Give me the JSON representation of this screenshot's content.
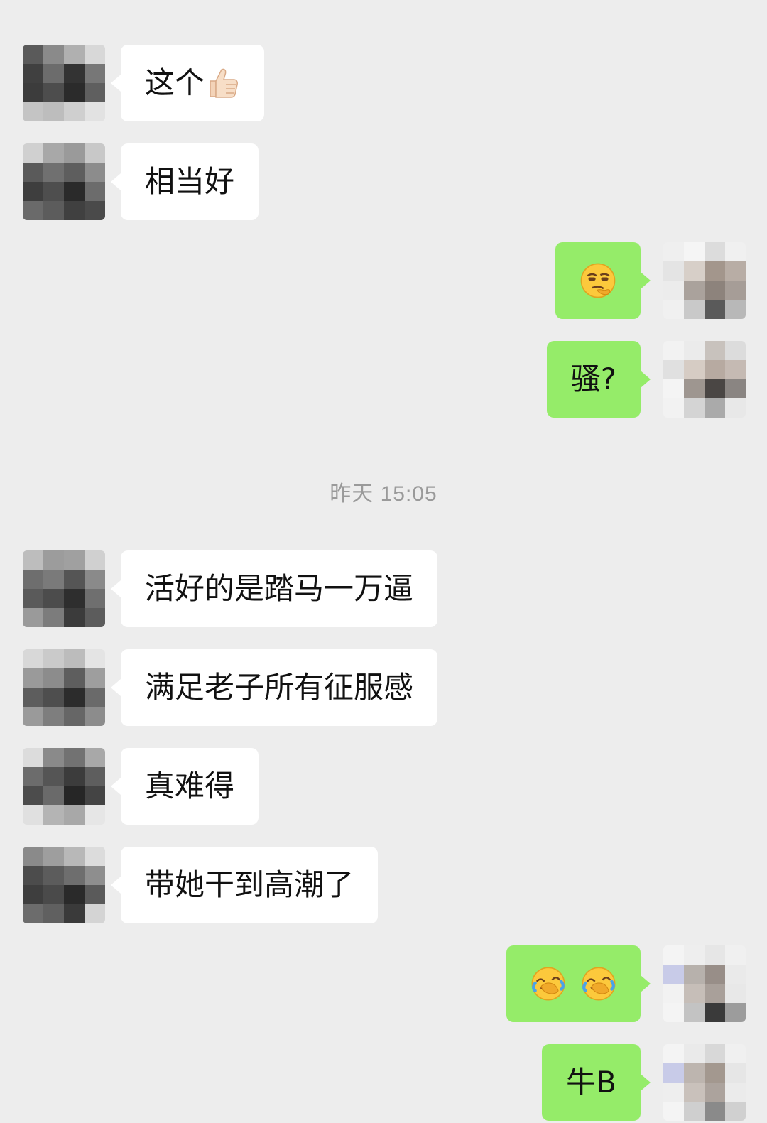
{
  "colors": {
    "background": "#ededed",
    "incoming_bubble": "#ffffff",
    "outgoing_bubble": "#95ec69",
    "timestamp_text": "#9a9a9a"
  },
  "messages": [
    {
      "side": "left",
      "text": "这个",
      "emoji": "thumbs-up-icon"
    },
    {
      "side": "left",
      "text": "相当好"
    },
    {
      "side": "right",
      "text": "",
      "emoji": "smirking-thinking-face-icon"
    },
    {
      "side": "right",
      "text": "骚?"
    },
    {
      "side": "left",
      "text": "活好的是踏马一万逼"
    },
    {
      "side": "left",
      "text": "满足老子所有征服感"
    },
    {
      "side": "left",
      "text": "真难得"
    },
    {
      "side": "left",
      "text": "带她干到高潮了"
    },
    {
      "side": "right",
      "text": "",
      "emoji": "facepalm-laughing-face-icon x2"
    },
    {
      "side": "right",
      "text": "牛B"
    }
  ],
  "timestamp": "昨天 15:05"
}
